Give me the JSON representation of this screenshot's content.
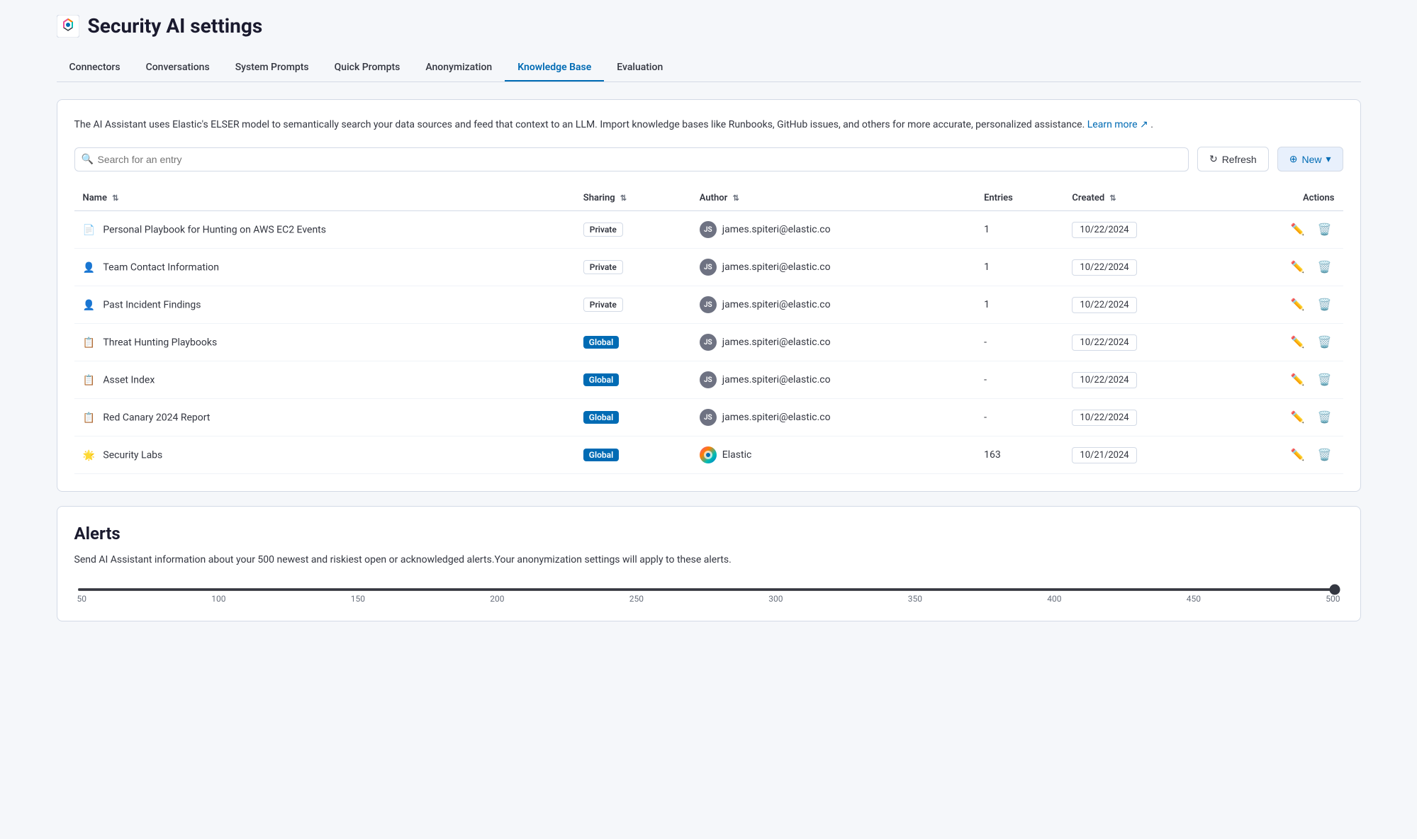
{
  "header": {
    "title": "Security AI settings"
  },
  "nav": {
    "tabs": [
      {
        "id": "connectors",
        "label": "Connectors",
        "active": false
      },
      {
        "id": "conversations",
        "label": "Conversations",
        "active": false
      },
      {
        "id": "system-prompts",
        "label": "System Prompts",
        "active": false
      },
      {
        "id": "quick-prompts",
        "label": "Quick Prompts",
        "active": false
      },
      {
        "id": "anonymization",
        "label": "Anonymization",
        "active": false
      },
      {
        "id": "knowledge-base",
        "label": "Knowledge Base",
        "active": true
      },
      {
        "id": "evaluation",
        "label": "Evaluation",
        "active": false
      }
    ]
  },
  "knowledge_base": {
    "description": "The AI Assistant uses Elastic's ELSER model to semantically search your data sources and feed that context to an LLM. Import knowledge bases like Runbooks, GitHub issues, and others for more accurate, personalized assistance.",
    "learn_more_text": "Learn more",
    "search_placeholder": "Search for an entry",
    "refresh_label": "Refresh",
    "new_label": "New",
    "table": {
      "columns": {
        "name": "Name",
        "sharing": "Sharing",
        "author": "Author",
        "entries": "Entries",
        "created": "Created",
        "actions": "Actions"
      },
      "rows": [
        {
          "id": 1,
          "icon_type": "document",
          "name": "Personal Playbook for Hunting on AWS EC2 Events",
          "sharing": "Private",
          "author_avatar": "JS",
          "author": "james.spiteri@elastic.co",
          "entries": "1",
          "created": "10/22/2024",
          "edit_disabled": false,
          "delete_disabled": false
        },
        {
          "id": 2,
          "icon_type": "person",
          "name": "Team Contact Information",
          "sharing": "Private",
          "author_avatar": "JS",
          "author": "james.spiteri@elastic.co",
          "entries": "1",
          "created": "10/22/2024",
          "edit_disabled": false,
          "delete_disabled": false
        },
        {
          "id": 3,
          "icon_type": "person",
          "name": "Past Incident Findings",
          "sharing": "Private",
          "author_avatar": "JS",
          "author": "james.spiteri@elastic.co",
          "entries": "1",
          "created": "10/22/2024",
          "edit_disabled": false,
          "delete_disabled": false
        },
        {
          "id": 4,
          "icon_type": "list",
          "name": "Threat Hunting Playbooks",
          "sharing": "Global",
          "author_avatar": "JS",
          "author": "james.spiteri@elastic.co",
          "entries": "-",
          "created": "10/22/2024",
          "edit_disabled": false,
          "delete_disabled": false
        },
        {
          "id": 5,
          "icon_type": "list",
          "name": "Asset Index",
          "sharing": "Global",
          "author_avatar": "JS",
          "author": "james.spiteri@elastic.co",
          "entries": "-",
          "created": "10/22/2024",
          "edit_disabled": false,
          "delete_disabled": false
        },
        {
          "id": 6,
          "icon_type": "list",
          "name": "Red Canary 2024 Report",
          "sharing": "Global",
          "author_avatar": "JS",
          "author": "james.spiteri@elastic.co",
          "entries": "-",
          "created": "10/22/2024",
          "edit_disabled": false,
          "delete_disabled": false
        },
        {
          "id": 7,
          "icon_type": "star",
          "name": "Security Labs",
          "sharing": "Global",
          "author_avatar": "elastic",
          "author": "Elastic",
          "entries": "163",
          "created": "10/21/2024",
          "edit_disabled": true,
          "delete_disabled": true
        }
      ]
    }
  },
  "alerts": {
    "title": "Alerts",
    "description": "Send AI Assistant information about your 500 newest and riskiest open or acknowledged alerts.Your anonymization settings will apply to these alerts.",
    "slider": {
      "min": 50,
      "max": 500,
      "value": 500,
      "step": 50,
      "labels": [
        "50",
        "100",
        "150",
        "200",
        "250",
        "300",
        "350",
        "400",
        "450",
        "500"
      ]
    }
  },
  "colors": {
    "active_tab": "#006bb4",
    "global_badge": "#006bb4",
    "private_badge_border": "#d3dae6",
    "edit_icon": "#006bb4",
    "delete_icon": "#bd271e",
    "disabled_icon": "#c5cdd8"
  }
}
